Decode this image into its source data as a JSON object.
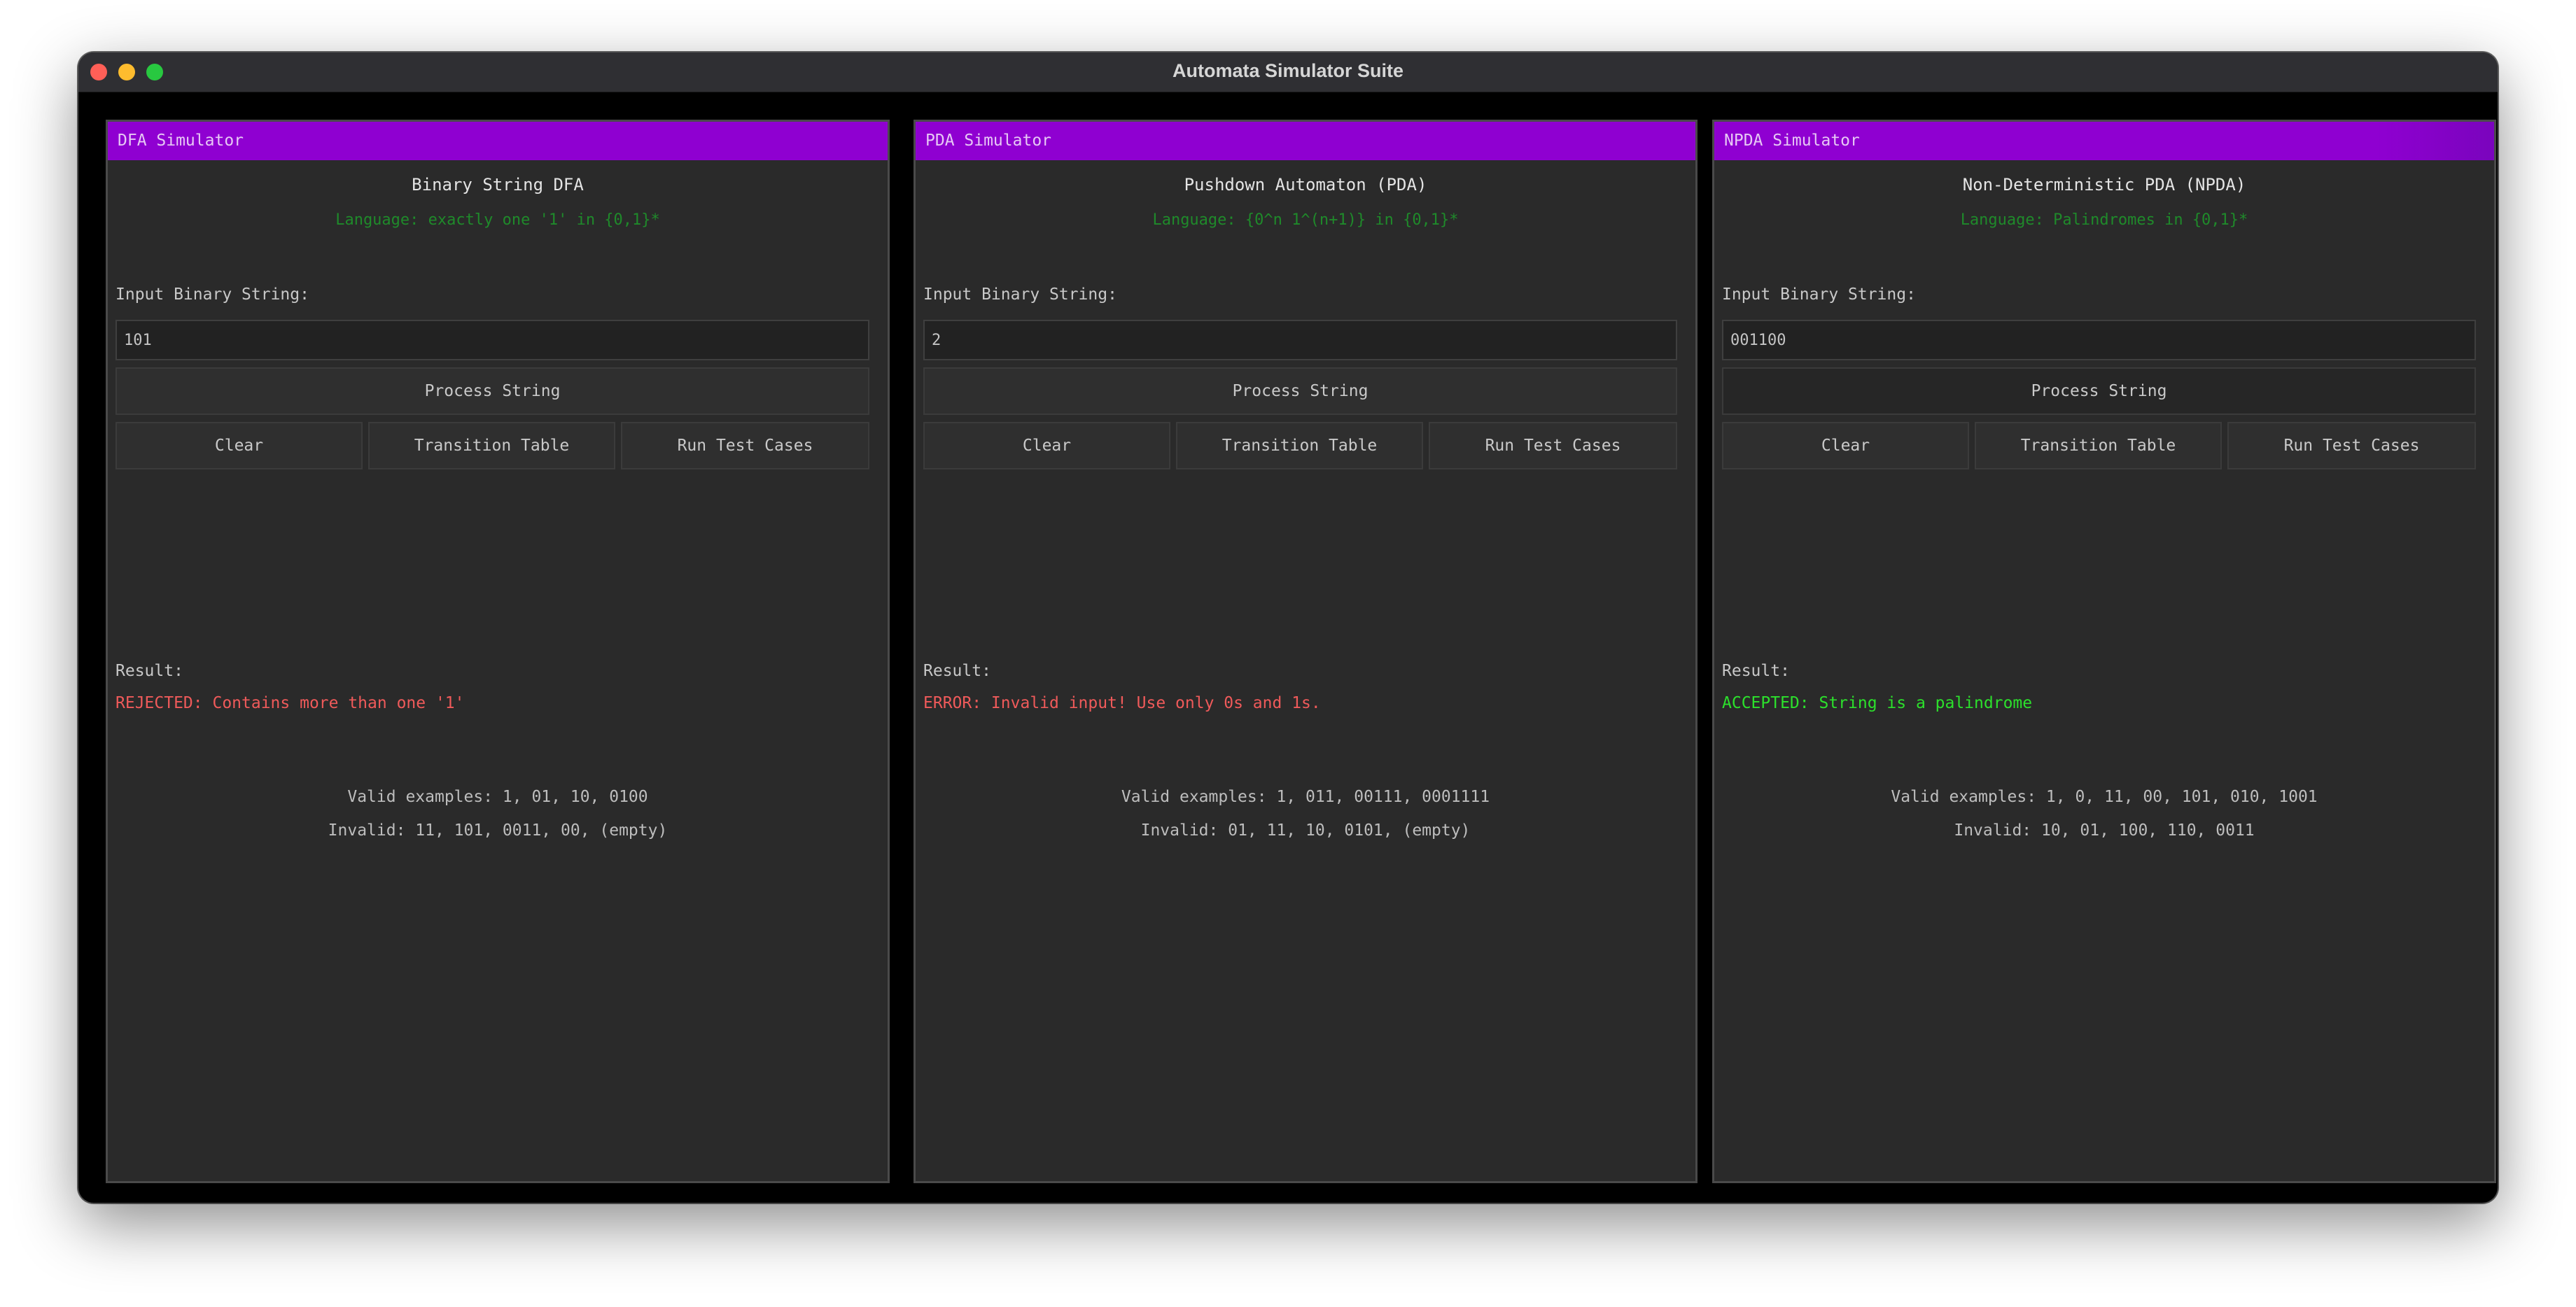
{
  "window": {
    "title": "Automata Simulator Suite"
  },
  "panels": [
    {
      "header": "DFA Simulator",
      "heading": "Binary String DFA",
      "language": "Language: exactly one '1' in {0,1}*",
      "input_label": "Input Binary String:",
      "input_value": "101",
      "process_label": "Process String",
      "clear_label": "Clear",
      "table_label": "Transition Table",
      "tests_label": "Run Test Cases",
      "result_label": "Result:",
      "result_text": "REJECTED: Contains more than one '1'",
      "result_status": "rejected",
      "valid_examples": "Valid examples: 1, 01, 10, 0100",
      "invalid_examples": "Invalid: 11, 101, 0011, 00, (empty)"
    },
    {
      "header": "PDA Simulator",
      "heading": "Pushdown Automaton (PDA)",
      "language": "Language: {0^n 1^(n+1)} in {0,1}*",
      "input_label": "Input Binary String:",
      "input_value": "2",
      "process_label": "Process String",
      "clear_label": "Clear",
      "table_label": "Transition Table",
      "tests_label": "Run Test Cases",
      "result_label": "Result:",
      "result_text": "ERROR: Invalid input! Use only 0s and 1s.",
      "result_status": "error",
      "valid_examples": "Valid examples: 1, 011, 00111, 0001111",
      "invalid_examples": "Invalid: 01, 11, 10, 0101, (empty)"
    },
    {
      "header": "NPDA Simulator",
      "heading": "Non-Deterministic PDA (NPDA)",
      "language": "Language: Palindromes in {0,1}*",
      "input_label": "Input Binary String:",
      "input_value": "001100",
      "process_label": "Process String",
      "clear_label": "Clear",
      "table_label": "Transition Table",
      "tests_label": "Run Test Cases",
      "result_label": "Result:",
      "result_text": "ACCEPTED: String is a palindrome",
      "result_status": "accepted",
      "valid_examples": "Valid examples: 1, 0, 11, 00, 101, 010, 1001",
      "invalid_examples": "Invalid: 10, 01, 100, 110, 0011"
    }
  ],
  "colors": {
    "header_bg": "#8f00d1",
    "header_text": "#e7c8f5",
    "language_text": "#1f8a2a",
    "rejected": "#ef5a5a",
    "accepted": "#2ce02c",
    "panel_bg": "#2a2a2a"
  }
}
